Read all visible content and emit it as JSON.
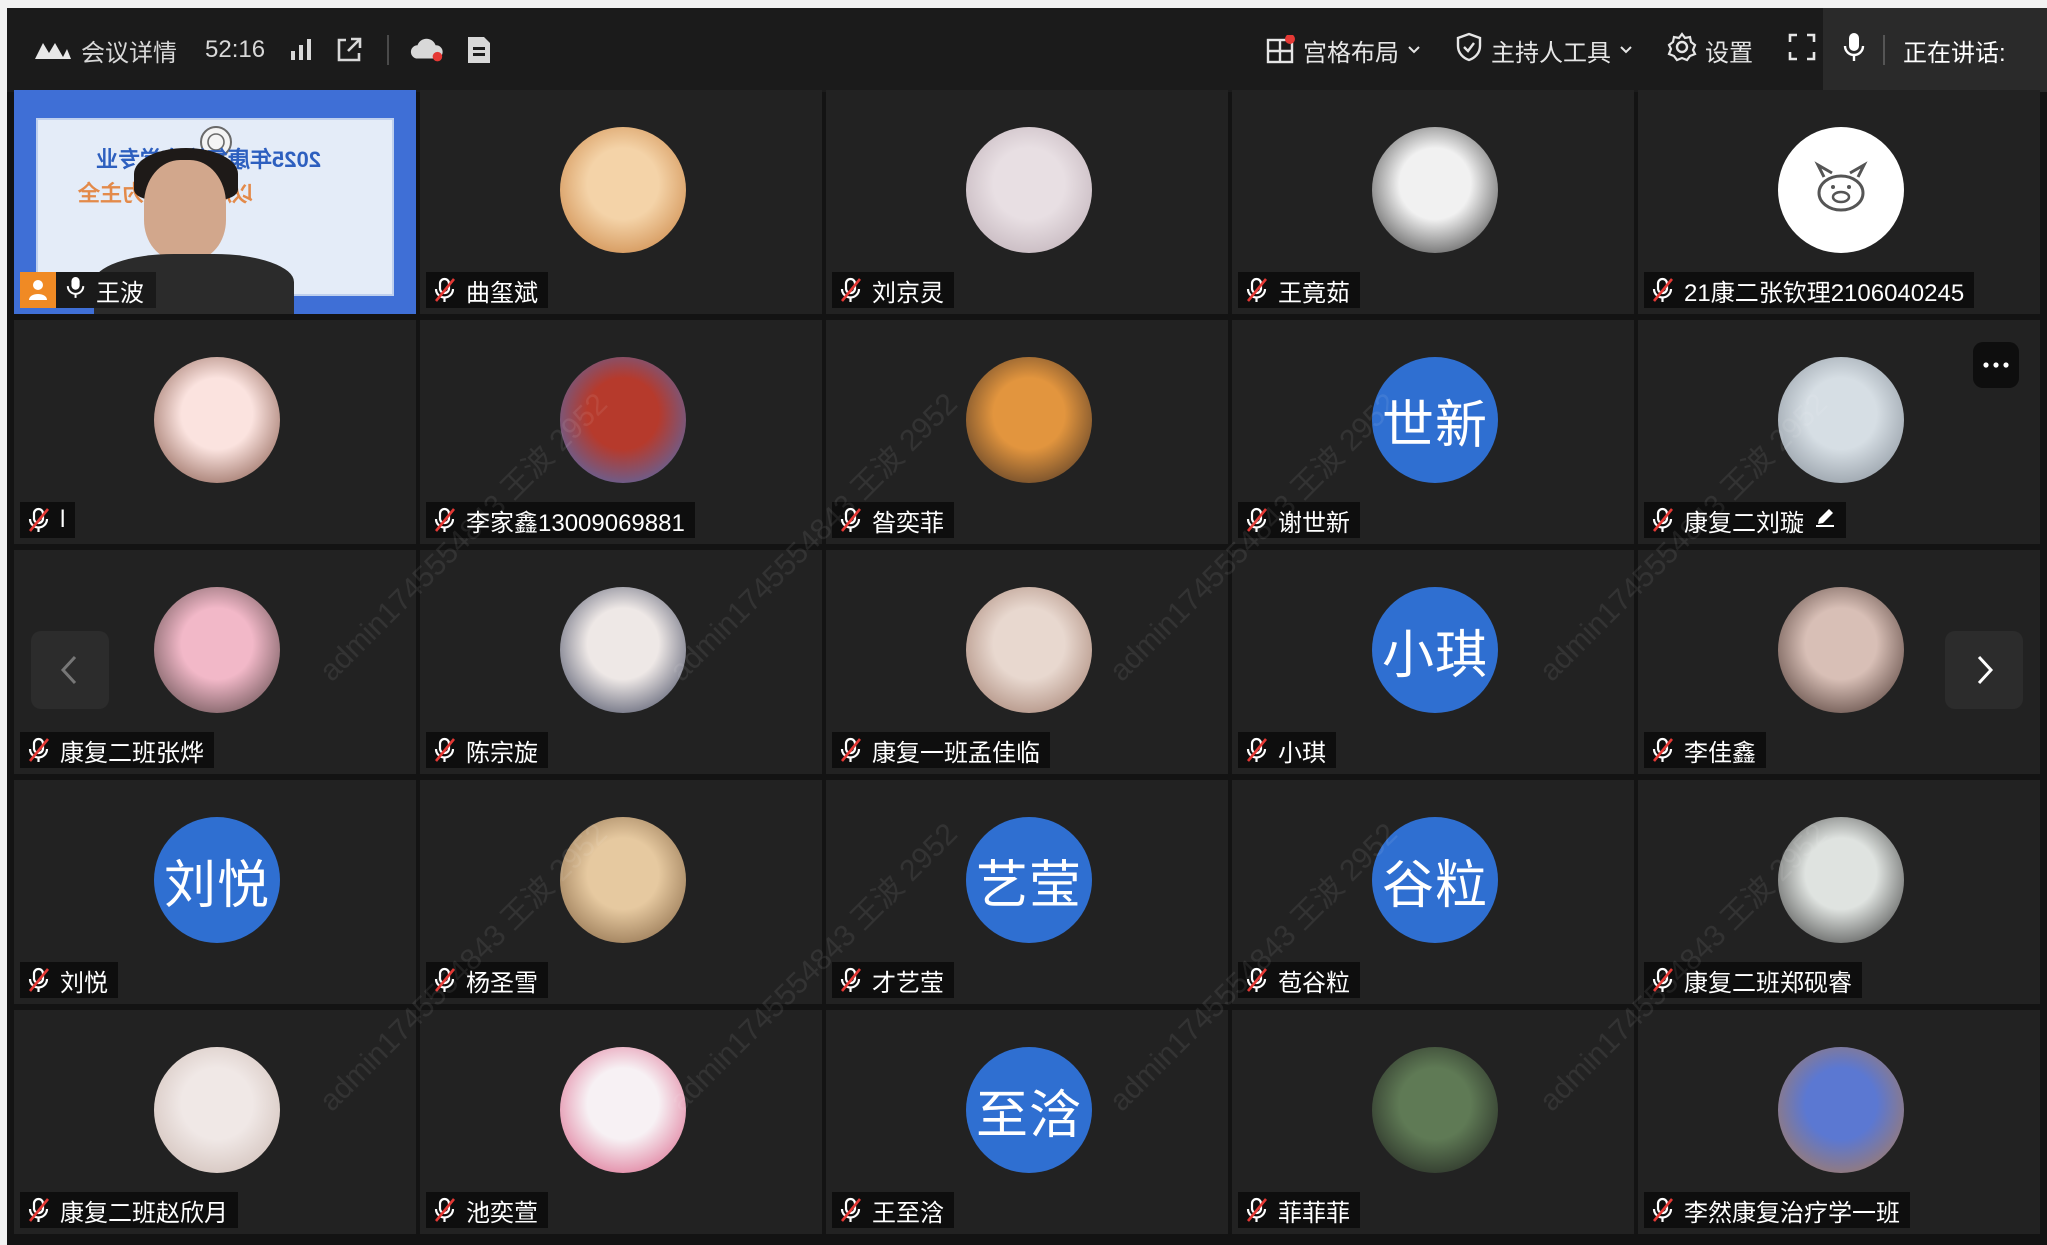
{
  "topbar": {
    "title": "会议详情",
    "timer": "52:16",
    "layout_label": "宫格布局",
    "host_tools_label": "主持人工具",
    "settings_label": "设置",
    "speaking_label": "正在讲话:"
  },
  "watermark_text": "admin1745554843 王波 2952",
  "colors": {
    "avatar_blue": "#2f6fd1",
    "host_badge": "#f08a24",
    "tile_bg": "#222222",
    "accent_red": "#e53935"
  },
  "participants": [
    {
      "name": "王波",
      "type": "video",
      "role": "host",
      "mic": "on",
      "slide_line1": "2025年康复治疗学专业",
      "slide_line2": "以风险防控为主全"
    },
    {
      "name": "曲玺斌",
      "type": "photo",
      "mic": "off",
      "avatar_icon": "shiba-dog-avatar"
    },
    {
      "name": "刘京灵",
      "type": "photo",
      "mic": "off",
      "avatar_icon": "blossom-avatar"
    },
    {
      "name": "王竟茹",
      "type": "photo",
      "mic": "off",
      "avatar_icon": "smiling-man-avatar"
    },
    {
      "name": "21康二张钦理2106040245",
      "type": "photo",
      "mic": "off",
      "avatar_icon": "pig-icon-avatar"
    },
    {
      "name": "l",
      "type": "photo",
      "mic": "off",
      "avatar_icon": "child-avatar"
    },
    {
      "name": "李家鑫13009069881",
      "type": "photo",
      "mic": "off",
      "avatar_icon": "mario-avatar"
    },
    {
      "name": "昝奕菲",
      "type": "photo",
      "mic": "off",
      "avatar_icon": "sunset-avatar"
    },
    {
      "name": "谢世新",
      "type": "text",
      "avatar_text": "世新",
      "mic": "off"
    },
    {
      "name": "康复二刘璇",
      "type": "photo",
      "mic": "off",
      "avatar_icon": "flower-girl-avatar",
      "editable": true
    },
    {
      "name": "康复二班张烨",
      "type": "photo",
      "mic": "off",
      "avatar_icon": "cartoon-girl-avatar"
    },
    {
      "name": "陈宗旋",
      "type": "photo",
      "mic": "off",
      "avatar_icon": "sitting-girl-avatar"
    },
    {
      "name": "康复一班孟佳临",
      "type": "photo",
      "mic": "off",
      "avatar_icon": "portrait-girl-avatar"
    },
    {
      "name": "小琪",
      "type": "text",
      "avatar_text": "小琪",
      "mic": "off"
    },
    {
      "name": "李佳鑫",
      "type": "photo",
      "mic": "off",
      "avatar_icon": "face-closeup-avatar"
    },
    {
      "name": "刘悦",
      "type": "text",
      "avatar_text": "刘悦",
      "mic": "off"
    },
    {
      "name": "杨圣雪",
      "type": "photo",
      "mic": "off",
      "avatar_icon": "golden-retriever-avatar"
    },
    {
      "name": "才艺莹",
      "type": "text",
      "avatar_text": "艺莹",
      "mic": "off"
    },
    {
      "name": "苞谷粒",
      "type": "text",
      "avatar_text": "谷粒",
      "mic": "off"
    },
    {
      "name": "康复二班郑砚睿",
      "type": "photo",
      "mic": "off",
      "avatar_icon": "glasses-boy-avatar"
    },
    {
      "name": "康复二班赵欣月",
      "type": "photo",
      "mic": "off",
      "avatar_icon": "ballet-avatar"
    },
    {
      "name": "池奕萱",
      "type": "photo",
      "mic": "off",
      "avatar_icon": "anime-pink-avatar"
    },
    {
      "name": "王至浛",
      "type": "text",
      "avatar_text": "至浛",
      "mic": "off"
    },
    {
      "name": "菲菲菲",
      "type": "photo",
      "mic": "off",
      "avatar_icon": "window-girl-avatar"
    },
    {
      "name": "李然康复治疗学一班",
      "type": "photo",
      "mic": "off",
      "avatar_icon": "cartoon-bear-avatar"
    }
  ]
}
